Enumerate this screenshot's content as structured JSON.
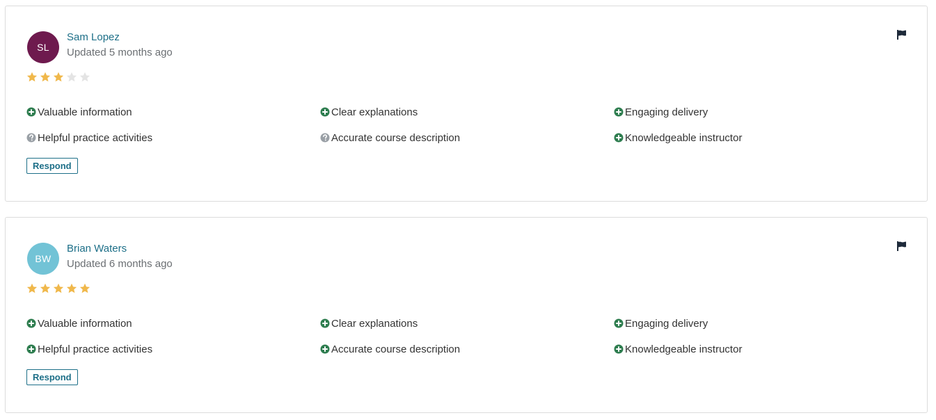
{
  "colors": {
    "link": "#1d6f88",
    "star_filled": "#f0b84b",
    "star_empty": "#e4e4e4",
    "positive_icon": "#2e7d4f",
    "neutral_icon": "#9aa0a6",
    "flag": "#1e2a3a"
  },
  "reviews": [
    {
      "initials": "SL",
      "avatar_color": "#6e1a4e",
      "name": "Sam Lopez",
      "updated": "Updated 5 months ago",
      "rating": 3,
      "max_rating": 5,
      "attributes": [
        {
          "label": "Valuable information",
          "status": "positive",
          "icon": "plus-circle-icon"
        },
        {
          "label": "Clear explanations",
          "status": "positive",
          "icon": "plus-circle-icon"
        },
        {
          "label": "Engaging delivery",
          "status": "positive",
          "icon": "plus-circle-icon"
        },
        {
          "label": "Helpful practice activities",
          "status": "neutral",
          "icon": "question-circle-icon"
        },
        {
          "label": "Accurate course description",
          "status": "neutral",
          "icon": "question-circle-icon"
        },
        {
          "label": "Knowledgeable instructor",
          "status": "positive",
          "icon": "plus-circle-icon"
        }
      ],
      "respond_label": "Respond",
      "flag_icon": "flag-icon"
    },
    {
      "initials": "BW",
      "avatar_color": "#72c3d6",
      "name": "Brian Waters",
      "updated": "Updated 6 months ago",
      "rating": 5,
      "max_rating": 5,
      "attributes": [
        {
          "label": "Valuable information",
          "status": "positive",
          "icon": "plus-circle-icon"
        },
        {
          "label": "Clear explanations",
          "status": "positive",
          "icon": "plus-circle-icon"
        },
        {
          "label": "Engaging delivery",
          "status": "positive",
          "icon": "plus-circle-icon"
        },
        {
          "label": "Helpful practice activities",
          "status": "positive",
          "icon": "plus-circle-icon"
        },
        {
          "label": "Accurate course description",
          "status": "positive",
          "icon": "plus-circle-icon"
        },
        {
          "label": "Knowledgeable instructor",
          "status": "positive",
          "icon": "plus-circle-icon"
        }
      ],
      "respond_label": "Respond",
      "flag_icon": "flag-icon"
    }
  ]
}
